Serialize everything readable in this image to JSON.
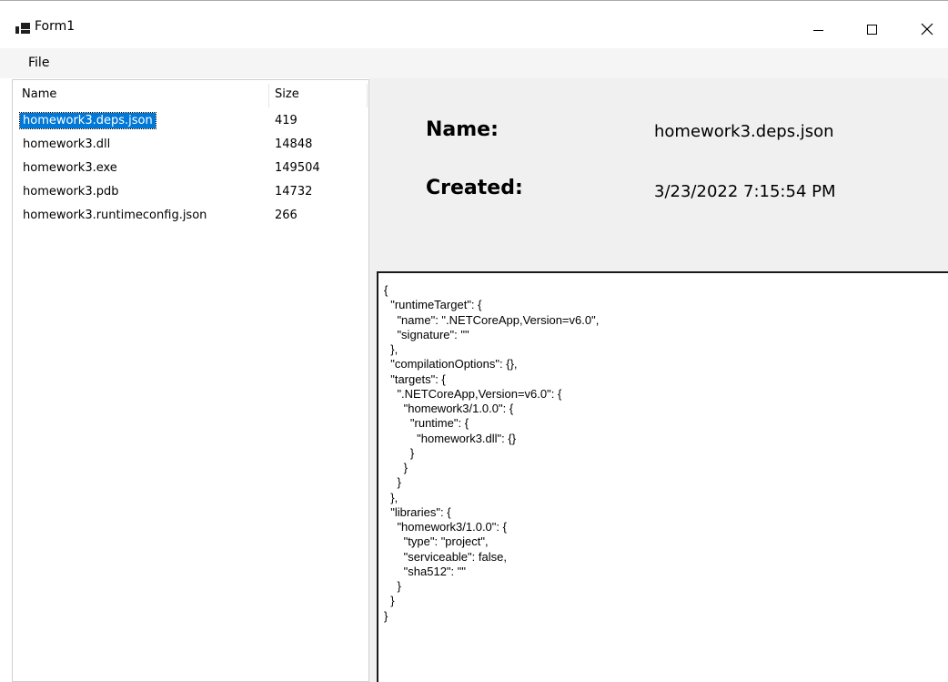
{
  "window": {
    "title": "Form1",
    "controls": {
      "minimize": "minimize",
      "maximize": "maximize",
      "close": "close"
    }
  },
  "menu": {
    "file": "File"
  },
  "listview": {
    "columns": {
      "name": "Name",
      "size": "Size"
    },
    "rows": [
      {
        "name": "homework3.deps.json",
        "size": "419",
        "selected": true
      },
      {
        "name": "homework3.dll",
        "size": "14848",
        "selected": false
      },
      {
        "name": "homework3.exe",
        "size": "149504",
        "selected": false
      },
      {
        "name": "homework3.pdb",
        "size": "14732",
        "selected": false
      },
      {
        "name": "homework3.runtimeconfig.json",
        "size": "266",
        "selected": false
      }
    ]
  },
  "details": {
    "name_label": "Name:",
    "name_value": "homework3.deps.json",
    "created_label": "Created:",
    "created_value": "3/23/2022 7:15:54 PM"
  },
  "file_content": "{\n  \"runtimeTarget\": {\n    \"name\": \".NETCoreApp,Version=v6.0\",\n    \"signature\": \"\"\n  },\n  \"compilationOptions\": {},\n  \"targets\": {\n    \".NETCoreApp,Version=v6.0\": {\n      \"homework3/1.0.0\": {\n        \"runtime\": {\n          \"homework3.dll\": {}\n        }\n      }\n    }\n  },\n  \"libraries\": {\n    \"homework3/1.0.0\": {\n      \"type\": \"project\",\n      \"serviceable\": false,\n      \"sha512\": \"\"\n    }\n  }\n}",
  "colors": {
    "selection": "#0078d7",
    "panel": "#f0f0f0",
    "menubar": "#f5f5f5"
  },
  "icons": [
    "app-icon",
    "minimize-icon",
    "maximize-icon",
    "close-icon"
  ]
}
